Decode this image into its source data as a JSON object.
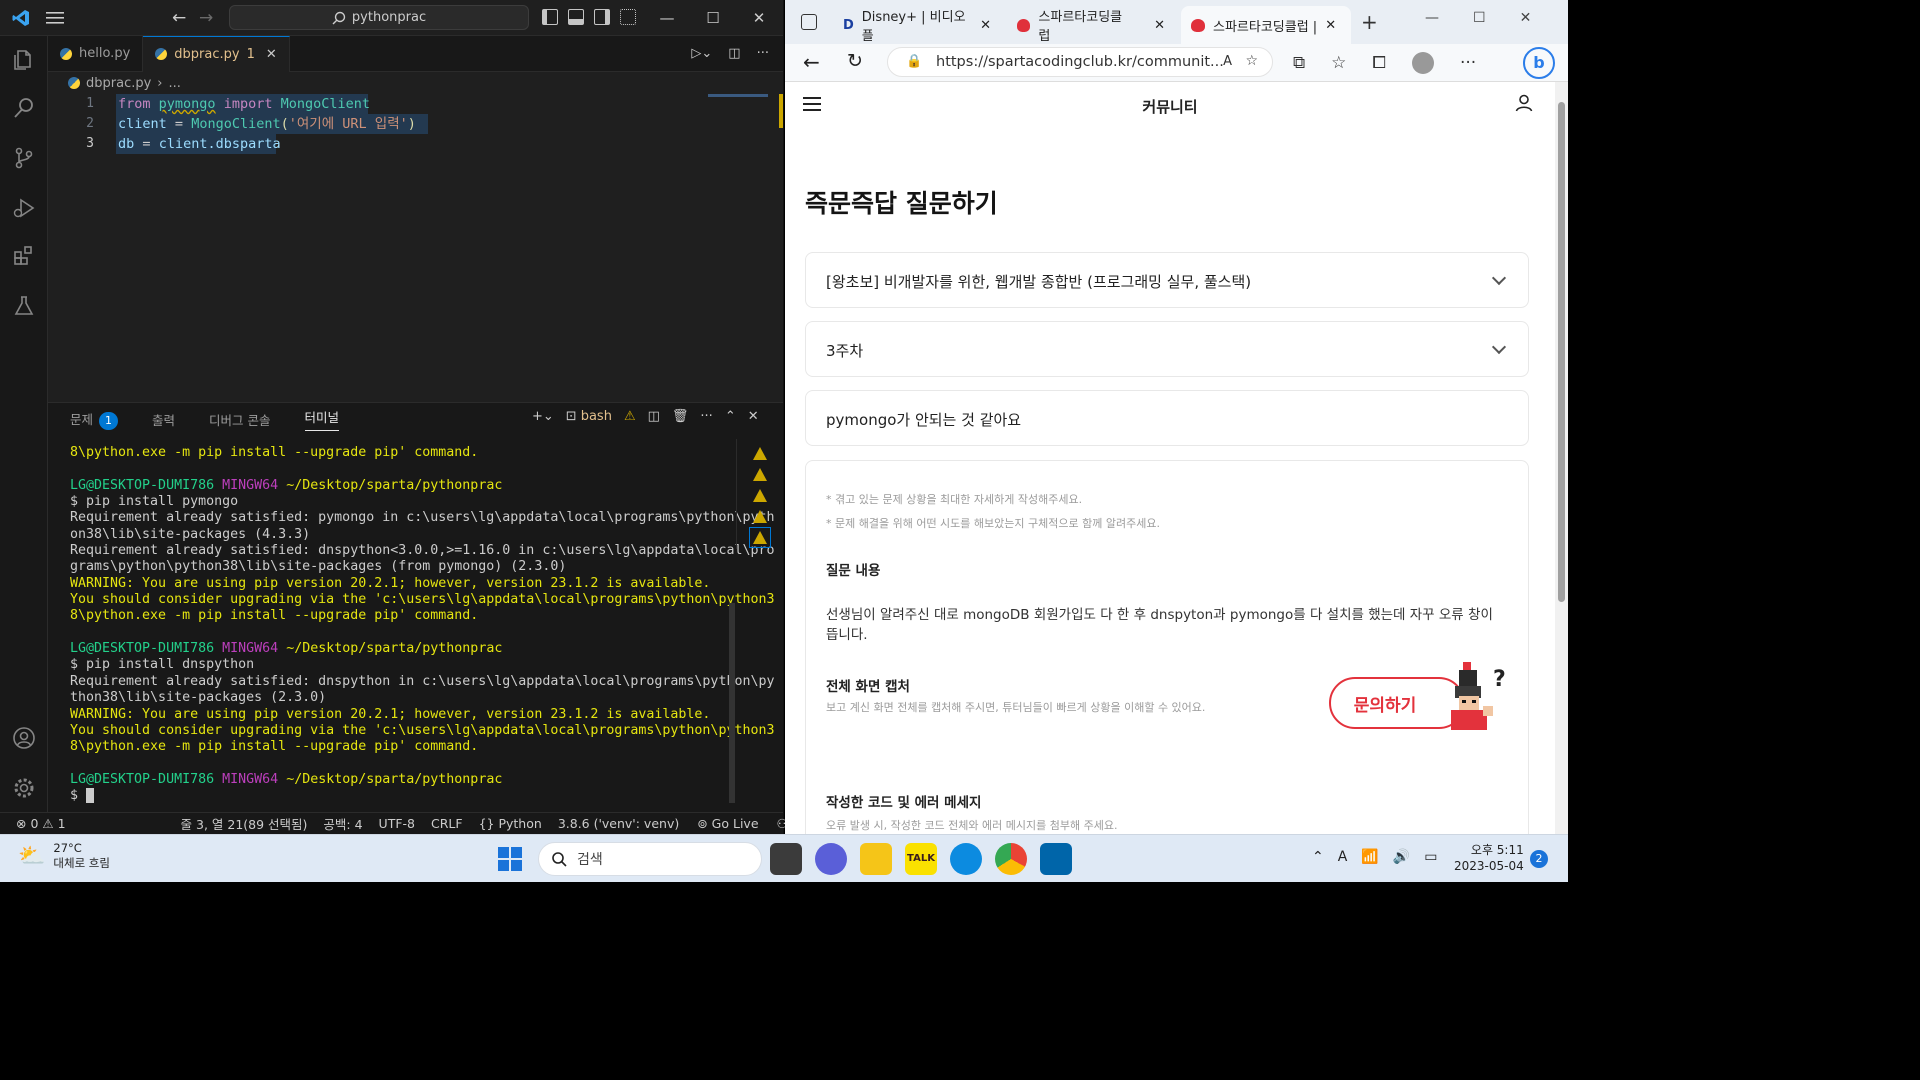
{
  "vscode": {
    "search": "pythonprac",
    "tabs": [
      {
        "name": "hello.py"
      },
      {
        "name": "dbprac.py",
        "badge": "1"
      }
    ],
    "breadcrumb": {
      "file": "dbprac.py",
      "rest": "..."
    },
    "code": {
      "line1": {
        "kw1": "from",
        "mod": "pymongo",
        "kw2": "import",
        "cls": "MongoClient"
      },
      "line2": {
        "var": "client",
        "op": "=",
        "cls": "MongoClient",
        "str": "'여기에 URL 입력'"
      },
      "line3": {
        "var": "db",
        "op": "=",
        "obj": "client",
        "attr": ".dbsparta"
      }
    },
    "line_numbers": [
      "1",
      "2",
      "3"
    ],
    "panel_tabs": {
      "problems": "문제",
      "problems_badge": "1",
      "output": "출력",
      "debug": "디버그 콘솔",
      "terminal": "터미널"
    },
    "terminal_label": "bash",
    "terminal": {
      "l1": "8\\python.exe -m pip install --upgrade pip' command.",
      "p1_user": "LG@DESKTOP-DUMI786",
      "p1_mingw": "MINGW64",
      "p1_path": "~/Desktop/sparta/pythonprac",
      "c1": "$ pip install pymongo",
      "l2": "Requirement already satisfied: pymongo in c:\\users\\lg\\appdata\\local\\programs\\python\\pyth",
      "l3": "on38\\lib\\site-packages (4.3.3)",
      "l4": "Requirement already satisfied: dnspython<3.0.0,>=1.16.0 in c:\\users\\lg\\appdata\\local\\pro",
      "l5": "grams\\python\\python38\\lib\\site-packages (from pymongo) (2.3.0)",
      "w1": "WARNING: You are using pip version 20.2.1; however, version 23.1.2 is available.",
      "w2": "You should consider upgrading via the 'c:\\users\\lg\\appdata\\local\\programs\\python\\python3",
      "w3": "8\\python.exe -m pip install --upgrade pip' command.",
      "c2": "$ pip install dnspython",
      "l6": "Requirement already satisfied: dnspython in c:\\users\\lg\\appdata\\local\\programs\\python\\py",
      "l7": "thon38\\lib\\site-packages (2.3.0)",
      "w4": "WARNING: You are using pip version 20.2.1; however, version 23.1.2 is available.",
      "w5": "You should consider upgrading via the 'c:\\users\\lg\\appdata\\local\\programs\\python\\python3",
      "w6": "8\\python.exe -m pip install --upgrade pip' command.",
      "c3": "$ "
    },
    "status": {
      "errors": "0",
      "warnings": "1",
      "position": "줄 3, 열 21(89 선택됨)",
      "spaces": "공백: 4",
      "encoding": "UTF-8",
      "eol": "CRLF",
      "lang": "Python",
      "interpreter": "3.8.6 ('venv': venv)",
      "golive": "Go Live"
    }
  },
  "browser": {
    "tabs": [
      {
        "title": "Disney+ | 비디오 플"
      },
      {
        "title": "스파르타코딩클럽"
      },
      {
        "title": "스파르타코딩클럽 |"
      }
    ],
    "url": "https://spartacodingclub.kr/communit...",
    "header_title": "커뮤니티",
    "page_title": "즉문즉답 질문하기",
    "course": "[왕초보] 비개발자를 위한, 웹개발 종합반 (프로그래밍 실무, 풀스택)",
    "week": "3주차",
    "question_title": "pymongo가 안되는 것 같아요",
    "hint1": "* 겪고 있는 문제 상황을 최대한 자세하게 작성해주세요.",
    "hint2": "* 문제 해결을 위해 어떤 시도를 해보았는지 구체적으로 함께 알려주세요.",
    "content_label": "질문 내용",
    "content": "선생님이 알려주신 대로 mongoDB 회원가입도 다 한 후 dnspyton과 pymongo를 다 설치를 했는데 자꾸 오류 창이 뜹니다.",
    "capture_label": "전체 화면 캡처",
    "capture_hint": "보고 계신 화면 전체를 캡처해 주시면, 튜터님들이 빠르게 상황을 이해할 수 있어요.",
    "code_label": "작성한 코드 및 에러 메세지",
    "code_hint": "오류 발생 시, 작성한 코드 전체와 에러 메시지를 첨부해 주세요.",
    "ask_button": "문의하기"
  },
  "taskbar": {
    "weather_temp": "27°C",
    "weather_desc": "대체로 흐림",
    "search": "검색",
    "time": "오후 5:11",
    "date": "2023-05-04",
    "notif": "2"
  },
  "colors": {
    "accent": "#0078d4",
    "sparta_red": "#e3323c",
    "warning": "#cca700"
  }
}
